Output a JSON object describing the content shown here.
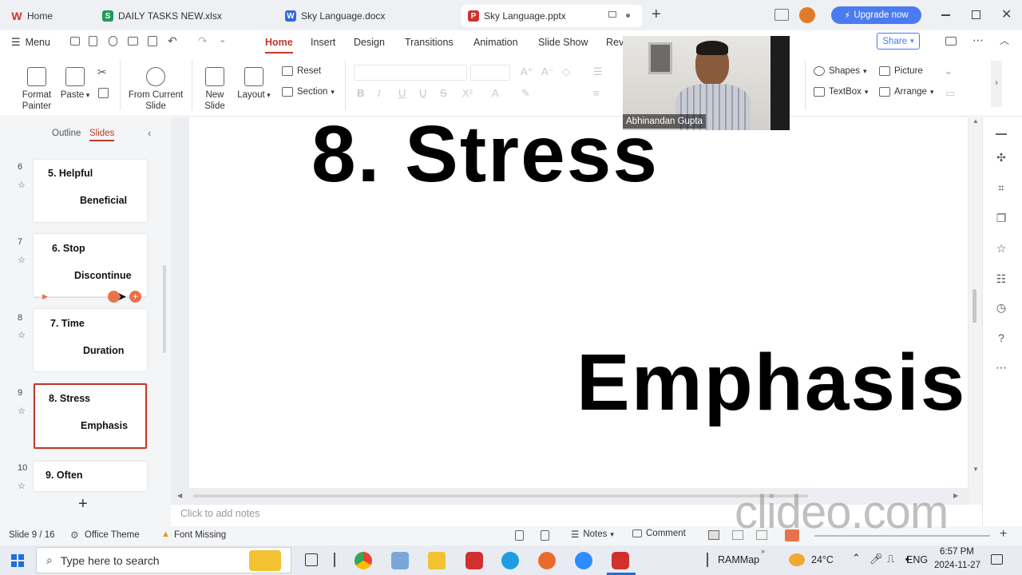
{
  "tabs": [
    {
      "label": "Home",
      "icon": "wps-logo-icon",
      "color": "#d0312d"
    },
    {
      "label": "DAILY TASKS NEW.xlsx",
      "icon": "spreadsheet-icon",
      "color": "#1e9b57",
      "letter": "S"
    },
    {
      "label": "Sky Language.docx",
      "icon": "document-icon",
      "color": "#2f6ad9",
      "letter": "W"
    },
    {
      "label": "Sky Language.pptx",
      "icon": "presentation-icon",
      "color": "#d0312d",
      "letter": "P"
    }
  ],
  "upgrade_label": "Upgrade now",
  "menu": {
    "menu_label": "Menu",
    "tabs": [
      "Home",
      "Insert",
      "Design",
      "Transitions",
      "Animation",
      "Slide Show",
      "Rev"
    ],
    "share_label": "Share"
  },
  "ribbon": {
    "format_painter": "Format Painter",
    "paste": "Paste",
    "from_current_slide": "From Current Slide",
    "new_slide": "New Slide",
    "layout": "Layout",
    "reset": "Reset",
    "section": "Section",
    "shapes": "Shapes",
    "picture": "Picture",
    "textbox": "TextBox",
    "arrange": "Arrange"
  },
  "panel": {
    "outline_tab": "Outline",
    "slides_tab": "Slides"
  },
  "slides": [
    {
      "num": "6",
      "title": "5. Helpful",
      "sub": "Beneficial"
    },
    {
      "num": "7",
      "title": "6. Stop",
      "sub": "Discontinue"
    },
    {
      "num": "8",
      "title": "7. Time",
      "sub": "Duration"
    },
    {
      "num": "9",
      "title": "8. Stress",
      "sub": "Emphasis"
    },
    {
      "num": "10",
      "title": "9. Often",
      "sub": ""
    }
  ],
  "current_slide": {
    "title": "8. Stress",
    "body": "Emphasis"
  },
  "notes_placeholder": "Click to add notes",
  "status": {
    "slide_counter": "Slide 9 / 16",
    "theme": "Office Theme",
    "font_missing": "Font Missing",
    "notes": "Notes",
    "comment": "Comment"
  },
  "video": {
    "participant": "Abhinandan Gupta"
  },
  "watermark": "clideo.com",
  "taskbar": {
    "search_placeholder": "Type here to search",
    "rammap": "RAMMap",
    "temperature": "24°C",
    "language": "ENG",
    "time": "6:57 PM",
    "date": "2024-11-27"
  }
}
